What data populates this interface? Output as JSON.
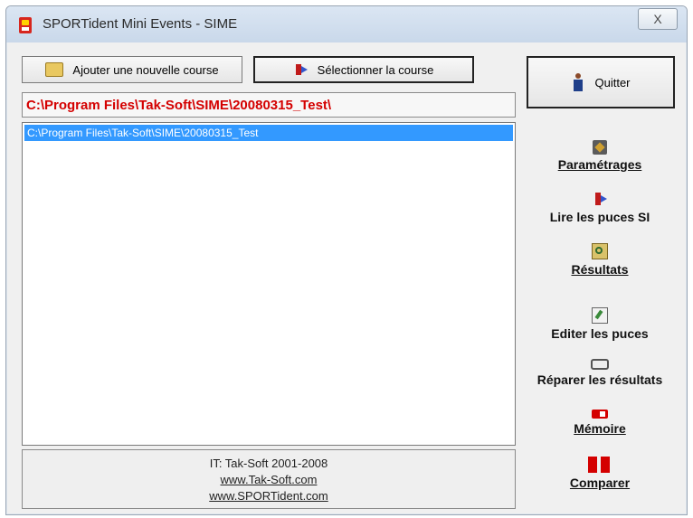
{
  "window": {
    "title": "SPORTident Mini Events - SIME",
    "close_label": "X"
  },
  "toolbar": {
    "add_course_label": "Ajouter une nouvelle course",
    "select_course_label": "Sélectionner la course",
    "quit_label": "Quitter"
  },
  "current_path": "C:\\Program Files\\Tak-Soft\\SIME\\20080315_Test\\",
  "course_list": {
    "items": [
      {
        "label": "C:\\Program Files\\Tak-Soft\\SIME\\20080315_Test",
        "selected": true
      }
    ]
  },
  "footer": {
    "copyright": "IT: Tak-Soft 2001-2008",
    "link1": "www.Tak-Soft.com",
    "link2": "www.SPORTident.com"
  },
  "side_menu": {
    "items": [
      {
        "label": "Paramétrages",
        "icon": "settings-icon"
      },
      {
        "label": "Lire les puces SI",
        "icon": "read-chips-icon"
      },
      {
        "label": "Résultats",
        "icon": "results-icon"
      },
      {
        "label": "Editer les puces",
        "icon": "edit-chips-icon"
      },
      {
        "label": "Réparer les résultats",
        "icon": "repair-icon"
      },
      {
        "label": "Mémoire",
        "icon": "memory-icon"
      },
      {
        "label": "Comparer",
        "icon": "compare-icon"
      }
    ]
  },
  "colors": {
    "path_text": "#d40000",
    "selection": "#3399ff"
  }
}
